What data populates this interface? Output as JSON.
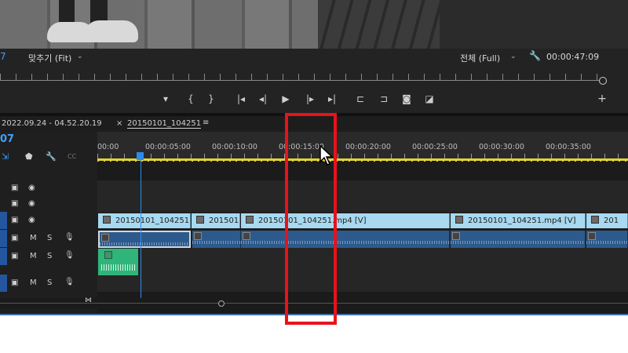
{
  "monitor": {
    "timecode_left": "7",
    "fit_label": "맞추기 (Fit)",
    "resolution_label": "전체 (Full)",
    "duration": "00:00:47:09"
  },
  "transport": {
    "buttons": [
      "marker",
      "mark-in",
      "mark-out",
      "go-to-in",
      "step-back",
      "play",
      "step-forward",
      "go-to-out",
      "lift",
      "extract",
      "export-frame",
      "comparison-view",
      "add"
    ],
    "glyphs": [
      "▾",
      "{",
      "}",
      "|◂",
      "◂|",
      "▶",
      "|▸",
      "▸|",
      "⊏",
      "⊐",
      "◙",
      "◪",
      "+"
    ]
  },
  "timeline": {
    "date_label": "2022.09.24 - 04.52.20.19",
    "sequence_tab": "20150101_104251",
    "timecode": "07",
    "ruler": [
      "00:00",
      "00:00:05:00",
      "00:00:10:00",
      "00:00:15:00",
      "00:00:20:00",
      "00:00:25:00",
      "00:00:30:00",
      "00:00:35:00"
    ],
    "video_clips": [
      "20150101_104251",
      "201501",
      "20150101_104251.mp4 [V]",
      "20150101_104251.mp4 [V]",
      "201"
    ],
    "audio_labels": {
      "m": "M",
      "s": "S"
    }
  },
  "colors": {
    "accent": "#3ea0ff",
    "video_clip": "#a7d9f0",
    "audio_clip": "#2d5a8c",
    "green_clip": "#2fb57a",
    "highlight": "#e8121b"
  }
}
